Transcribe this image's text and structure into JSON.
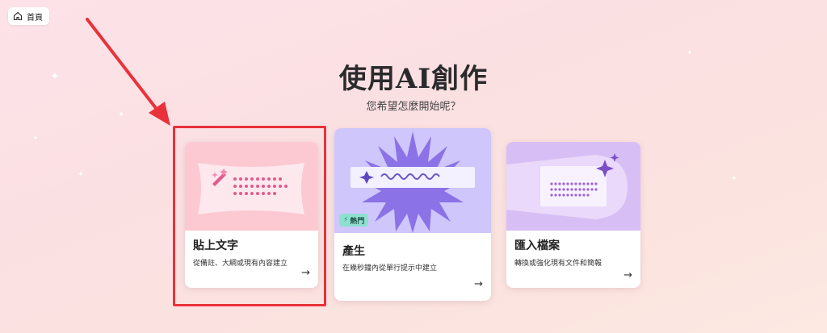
{
  "nav": {
    "home_label": "首頁"
  },
  "header": {
    "title": "使用AI創作",
    "subtitle": "您希望怎麼開始呢？"
  },
  "cards": [
    {
      "label": "貼上文字",
      "desc": "從備註、大綱或現有內容建立",
      "arrow": "→"
    },
    {
      "label": "產生",
      "desc": "在幾秒鐘內從單行提示中建立",
      "arrow": "→",
      "badge": "熱門"
    },
    {
      "label": "匯入檔案",
      "desc": "轉換或強化現有文件和簡報",
      "arrow": "→"
    }
  ],
  "colors": {
    "highlight": "#e8323c",
    "badge": "#8ee0d0",
    "generate_accent": "#8b72e6",
    "paste_accent": "#e35a8c"
  }
}
